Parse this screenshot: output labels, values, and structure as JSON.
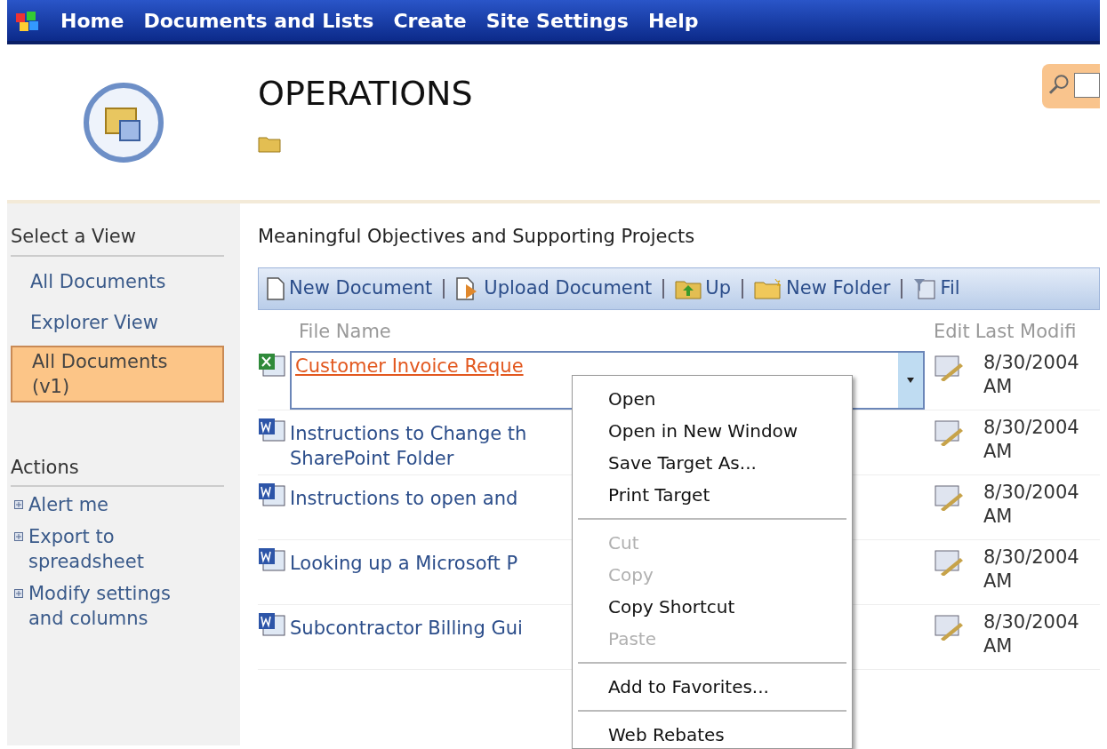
{
  "nav": [
    "Home",
    "Documents and Lists",
    "Create",
    "Site Settings",
    "Help"
  ],
  "site_title": "OPERATIONS",
  "sidebar": {
    "views_heading": "Select a View",
    "views": [
      {
        "label": "All Documents",
        "selected": false
      },
      {
        "label": "Explorer View",
        "selected": false
      },
      {
        "label": "All Documents (v1)",
        "selected": true
      }
    ],
    "actions_heading": "Actions",
    "actions": [
      "Alert me",
      "Export to spreadsheet",
      "Modify settings and columns"
    ]
  },
  "list_title": "Meaningful Objectives and Supporting Projects",
  "toolbar": [
    "New Document",
    "Upload Document",
    "Up",
    "New Folder",
    "Fil"
  ],
  "columns": [
    "File Name",
    "Edit",
    "Last Modifi"
  ],
  "rows": [
    {
      "name": "Customer Invoice Reque",
      "kind": "excel",
      "selected": true,
      "date": "8/30/2004",
      "time": "AM"
    },
    {
      "name": "Instructions to Change th SharePoint Folder",
      "kind": "word",
      "selected": false,
      "date": "8/30/2004",
      "time": "AM"
    },
    {
      "name": "Instructions to open and",
      "kind": "word",
      "selected": false,
      "date": "8/30/2004",
      "time": "AM"
    },
    {
      "name": "Looking up a Microsoft P",
      "kind": "word",
      "selected": false,
      "date": "8/30/2004",
      "time": "AM"
    },
    {
      "name": "Subcontractor Billing Gui",
      "kind": "word",
      "selected": false,
      "date": "8/30/2004",
      "time": "AM"
    }
  ],
  "context_menu": [
    {
      "kind": "item",
      "label": "Open",
      "disabled": false
    },
    {
      "kind": "item",
      "label": "Open in New Window",
      "disabled": false
    },
    {
      "kind": "item",
      "label": "Save Target As...",
      "disabled": false
    },
    {
      "kind": "item",
      "label": "Print Target",
      "disabled": false
    },
    {
      "kind": "separator"
    },
    {
      "kind": "item",
      "label": "Cut",
      "disabled": true
    },
    {
      "kind": "item",
      "label": "Copy",
      "disabled": true
    },
    {
      "kind": "item",
      "label": "Copy Shortcut",
      "disabled": false
    },
    {
      "kind": "item",
      "label": "Paste",
      "disabled": true
    },
    {
      "kind": "separator"
    },
    {
      "kind": "item",
      "label": "Add to Favorites...",
      "disabled": false
    },
    {
      "kind": "separator"
    },
    {
      "kind": "item",
      "label": "Web Rebates",
      "disabled": false
    }
  ]
}
